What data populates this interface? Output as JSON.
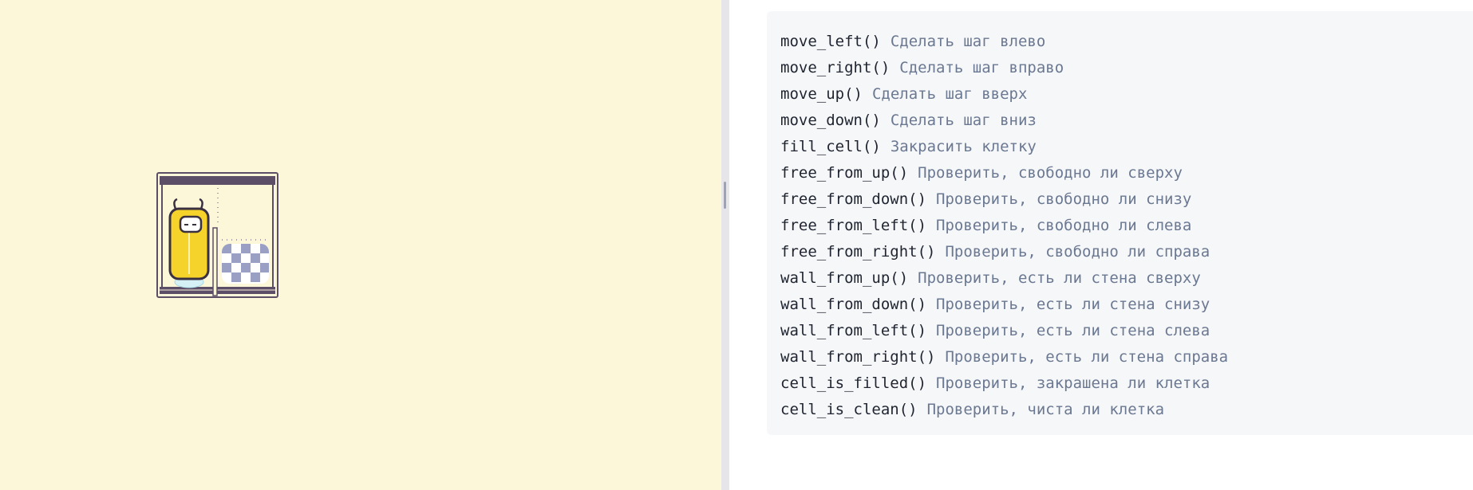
{
  "game": {
    "robot": {
      "icon": "robot-icon",
      "color": "#f6d32b"
    },
    "board": {
      "rows": 1,
      "cols": 2,
      "walls_color": "#5d4e68",
      "filled_color": "#9aa0c4"
    }
  },
  "commands": [
    {
      "name": "move_left()",
      "desc": "Сделать шаг влево"
    },
    {
      "name": "move_right()",
      "desc": "Сделать шаг вправо"
    },
    {
      "name": "move_up()",
      "desc": "Сделать шаг вверх"
    },
    {
      "name": "move_down()",
      "desc": "Сделать шаг вниз"
    },
    {
      "name": "fill_cell()",
      "desc": "Закрасить клетку"
    },
    {
      "name": "free_from_up()",
      "desc": "Проверить, свободно ли сверху"
    },
    {
      "name": "free_from_down()",
      "desc": "Проверить, свободно ли снизу"
    },
    {
      "name": "free_from_left()",
      "desc": "Проверить, свободно ли слева"
    },
    {
      "name": "free_from_right()",
      "desc": "Проверить, свободно ли справа"
    },
    {
      "name": "wall_from_up()",
      "desc": "Проверить, есть ли стена сверху"
    },
    {
      "name": "wall_from_down()",
      "desc": "Проверить, есть ли стена снизу"
    },
    {
      "name": "wall_from_left()",
      "desc": "Проверить, есть ли стена слева"
    },
    {
      "name": "wall_from_right()",
      "desc": "Проверить, есть ли стена справа"
    },
    {
      "name": "cell_is_filled()",
      "desc": "Проверить, закрашена ли клетка"
    },
    {
      "name": "cell_is_clean()",
      "desc": "Проверить, чиста ли клетка"
    }
  ]
}
